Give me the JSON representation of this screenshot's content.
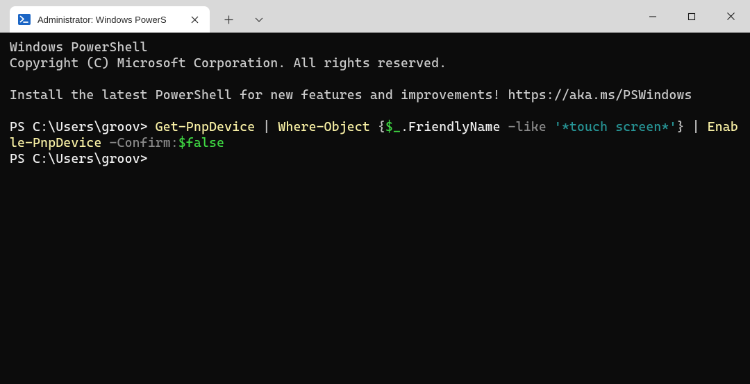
{
  "tab": {
    "title": "Administrator: Windows PowerS"
  },
  "terminal": {
    "banner_line1": "Windows PowerShell",
    "banner_line2": "Copyright (C) Microsoft Corporation. All rights reserved.",
    "banner_line3": "Install the latest PowerShell for new features and improvements! https://aka.ms/PSWindows",
    "prompt1": "PS C:\\Users\\groov> ",
    "cmd1_tok1": "Get-PnpDevice",
    "cmd1_pipe1": " | ",
    "cmd1_tok2": "Where-Object",
    "cmd1_br1": " {",
    "cmd1_var": "$_",
    "cmd1_prop": ".FriendlyName",
    "cmd1_param1": " -like ",
    "cmd1_str": "'*touch screen*'",
    "cmd1_br2": "}",
    "cmd1_pipe2": " | ",
    "cmd1_tok3": "Enable-PnpDevice",
    "cmd1_param2": " -Confirm:",
    "cmd1_bool": "$false",
    "prompt2": "PS C:\\Users\\groov>"
  }
}
